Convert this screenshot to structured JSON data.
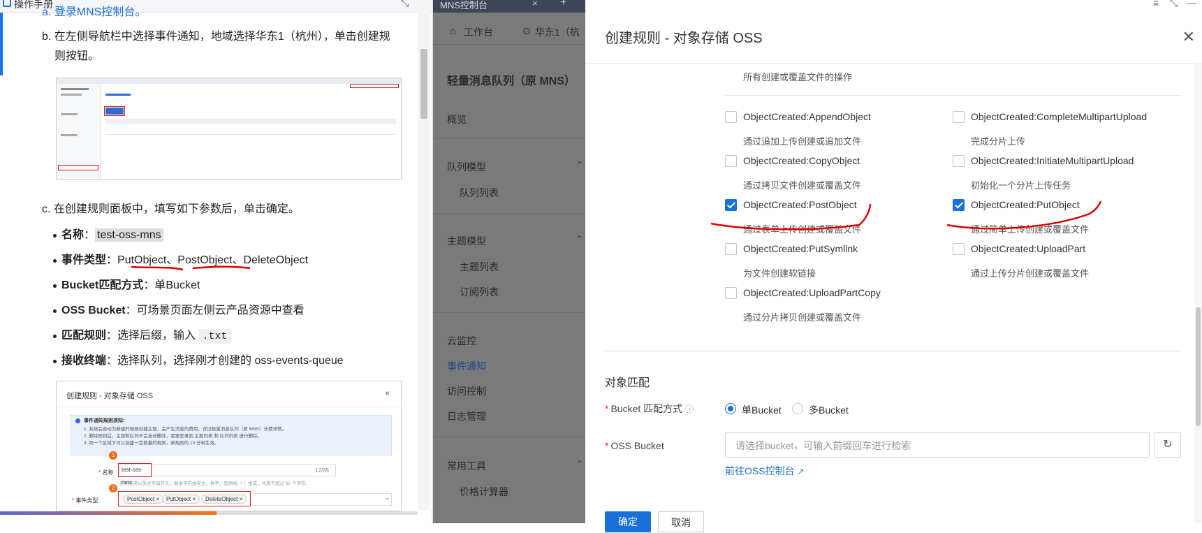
{
  "left": {
    "window_title": "操作手册",
    "step_a": "a. 登录MNS控制台。",
    "step_b_line1": "b. 在左侧导航栏中选择事件通知，地域选择华东1（杭州），单击创建规",
    "step_b_line2": "则按钮。",
    "step_c": "c. 在创建规则面板中，填写如下参数后，单击确定。",
    "bullets": [
      {
        "k": "名称",
        "v": "test-oss-mns"
      },
      {
        "k": "事件类型",
        "v": "PutObject、PostObject、DeleteObject"
      },
      {
        "k": "Bucket匹配方式",
        "v": "单Bucket"
      },
      {
        "k": "OSS Bucket",
        "v": "可场景页面左侧云产品资源中查看"
      },
      {
        "k": "匹配规则",
        "v": "选择后缀，输入",
        "code": ".txt"
      },
      {
        "k": "接收终端",
        "v": "选择队列，选择刚才创建的 oss-events-queue"
      }
    ],
    "thumb2": {
      "title": "创建规则 - 对象存储 OSS",
      "notice_title": "事件通知规则须知:",
      "notice_lines": [
        "1. 系统会自动为新建的规则创建主题，会产生消息的费用，详见轻量消息队列（原 MNS）计费详情。",
        "2. 删除规则后，主题和队列不会自动删除，需要登录到 主题列表 和 队列列表 进行删除。",
        "3. 同一个区域下可以创建一定数量的规则，新规则的 10 分钟生效。"
      ],
      "name_label": "名称",
      "name_value": "test-oss-mns",
      "name_count": "12/85",
      "name_hint": "名称必须以英文字母开头，剩余字符由英文、数字、短划线（-）组成，长度不超过 85 个字符。",
      "event_label": "事件类型",
      "tags": [
        "PostObject",
        "PutObject",
        "DeleteObject"
      ]
    }
  },
  "mid": {
    "tab_title": "MNS控制台",
    "crumb_home": "工作台",
    "crumb_region": "华东1（杭",
    "product": "轻量消息队列（原 MNS）",
    "items": {
      "overview": "概览",
      "queue_model": "队列模型",
      "queue_list": "队列列表",
      "topic_model": "主题模型",
      "topic_list": "主题列表",
      "sub_list": "订阅列表",
      "cloud_monitor": "云监控",
      "event_notify": "事件通知",
      "access_control": "访问控制",
      "log_mgmt": "日志管理",
      "tools": "常用工具",
      "price_calc": "价格计算器"
    }
  },
  "panel": {
    "title": "创建规则 - 对象存储 OSS",
    "top_desc": "所有创建或覆盖文件的操作",
    "events": [
      {
        "label": "ObjectCreated:AppendObject",
        "desc": "通过追加上传创建或追加文件",
        "checked": false
      },
      {
        "label": "ObjectCreated:CompleteMultipartUpload",
        "desc": "完成分片上传",
        "checked": false
      },
      {
        "label": "ObjectCreated:CopyObject",
        "desc": "通过拷贝文件创建或覆盖文件",
        "checked": false
      },
      {
        "label": "ObjectCreated:InitiateMultipartUpload",
        "desc": "初始化一个分片上传任务",
        "checked": false
      },
      {
        "label": "ObjectCreated:PostObject",
        "desc": "通过表单上传创建或覆盖文件",
        "checked": true
      },
      {
        "label": "ObjectCreated:PutObject",
        "desc": "通过简单上传创建或覆盖文件",
        "checked": true
      },
      {
        "label": "ObjectCreated:PutSymlink",
        "desc": "为文件创建软链接",
        "checked": false
      },
      {
        "label": "ObjectCreated:UploadPart",
        "desc": "通过上传分片创建或覆盖文件",
        "checked": false
      },
      {
        "label": "ObjectCreated:UploadPartCopy",
        "desc": "通过分片拷贝创建或覆盖文件",
        "checked": false
      }
    ],
    "object_match": "对象匹配",
    "bucket_mode_label": "Bucket 匹配方式",
    "single_bucket": "单Bucket",
    "multi_bucket": "多Bucket",
    "oss_bucket_label": "OSS Bucket",
    "bucket_placeholder": "请选择bucket，可输入前缀回车进行检索",
    "goto_oss": "前往OSS控制台",
    "confirm": "确定",
    "cancel": "取消"
  },
  "colors": {
    "accent": "#1a6fd9",
    "annotation": "#e00000"
  }
}
